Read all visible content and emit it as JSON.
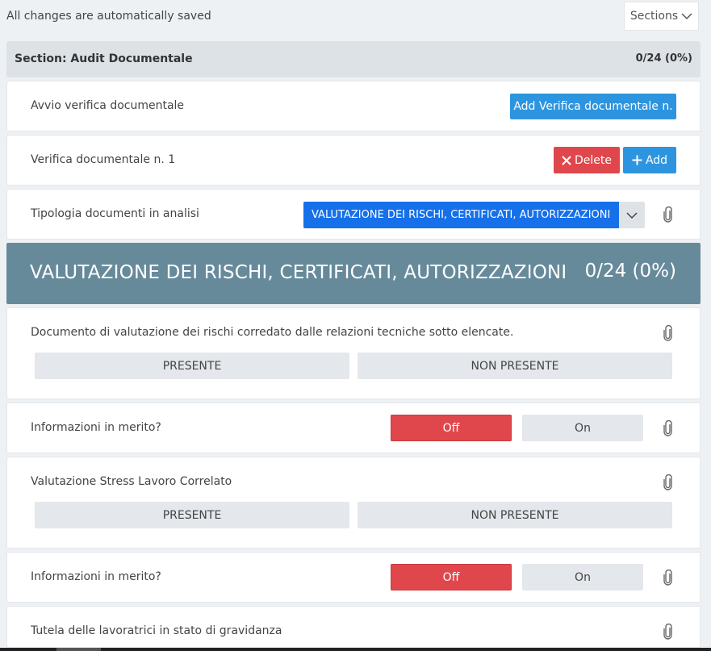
{
  "topbar": {
    "autosave_text": "All changes are automatically saved",
    "sections_label": "Sections"
  },
  "section": {
    "title": "Section: Audit Documentale",
    "score": "0/24 (0%)"
  },
  "avvio": {
    "label": "Avvio verifica documentale",
    "add_button": "Add Verifica documentale n."
  },
  "verifica": {
    "label": "Verifica documentale n. 1",
    "delete_button": "Delete",
    "add_button": "Add"
  },
  "tipologia": {
    "label": "Tipologia documenti in analisi",
    "selected": "VALUTAZIONE DEI RISCHI, CERTIFICATI, AUTORIZZAZIONI"
  },
  "banner": {
    "title": "VALUTAZIONE DEI RISCHI, CERTIFICATI, AUTORIZZAZIONI",
    "score": "0/24 (0%)"
  },
  "questions": [
    {
      "label": "Documento di valutazione dei rischi corredato dalle relazioni tecniche sotto elencate.",
      "option_a": "PRESENTE",
      "option_b": "NON PRESENTE"
    },
    {
      "label": "Informazioni in merito?",
      "off_label": "Off",
      "on_label": "On",
      "state": "off"
    },
    {
      "label": "Valutazione Stress Lavoro Correlato",
      "option_a": "PRESENTE",
      "option_b": "NON PRESENTE"
    },
    {
      "label": "Informazioni in merito?",
      "off_label": "Off",
      "on_label": "On",
      "state": "off"
    },
    {
      "label": "Tutela delle lavoratrici in stato di gravidanza"
    }
  ],
  "colors": {
    "primary": "#2d95e0",
    "danger": "#e0474c",
    "select_blue": "#1570ea",
    "banner": "#678a9b",
    "background": "#eef1f4"
  }
}
